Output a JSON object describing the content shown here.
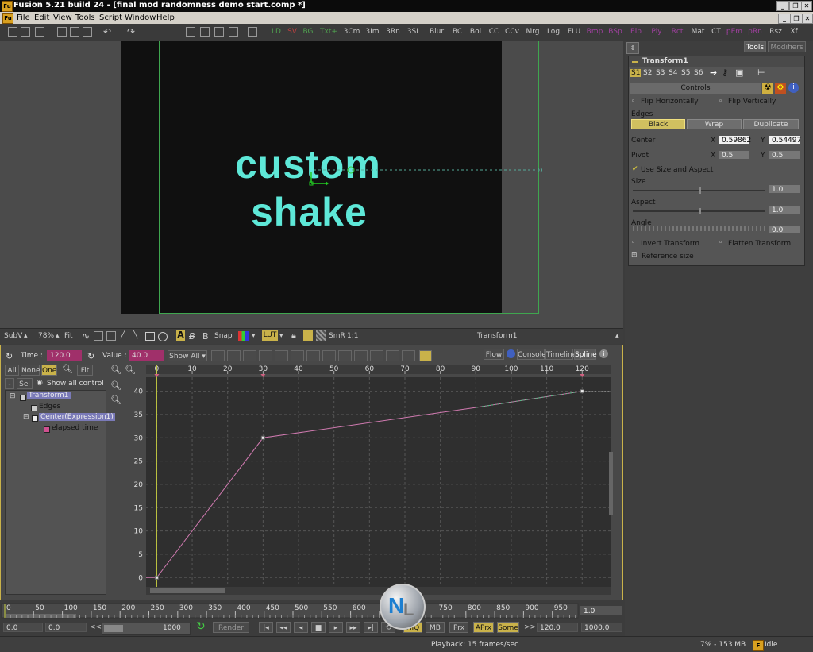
{
  "window": {
    "title": "Fusion 5.21 build 24 - [final mod randomness demo start.comp *]",
    "app_icon": "Fu"
  },
  "menu": [
    "File",
    "Edit",
    "View",
    "Tools",
    "Script",
    "Window",
    "Help"
  ],
  "toolbar": {
    "buttons": [
      "LD",
      "SV",
      "BG",
      "Txt+",
      "3Cm",
      "3Im",
      "3Rn",
      "3SL",
      "Blur",
      "BC",
      "Bol",
      "CC",
      "CCv",
      "Mrg",
      "Log",
      "FLU",
      "Bmp",
      "BSp",
      "Elp",
      "Ply",
      "Rct",
      "Mat",
      "CT",
      "pEm",
      "pRn",
      "Rsz",
      "Xf"
    ],
    "colors": {
      "LD": "#4fa04f",
      "SV": "#c04040",
      "BG": "#4fa04f",
      "Txt+": "#4fa04f",
      "pEm": "#a040a0",
      "pRn": "#a040a0",
      "Bmp": "#a040a0",
      "BSp": "#a040a0",
      "Elp": "#a040a0",
      "Ply": "#a040a0",
      "Rct": "#a040a0"
    }
  },
  "viewer": {
    "text_line1": "custom",
    "text_line2": "shake",
    "text_color": "#5ee8d8",
    "frame_color": "#3fa64f"
  },
  "viewer_bar": {
    "subview": "SubV",
    "zoom": "78%",
    "fit": "Fit",
    "letters": [
      "A",
      "B"
    ],
    "snap": "Snap",
    "lut": "LUT",
    "smr": "SmR",
    "ratio": "1:1",
    "tool_name": "Transform1"
  },
  "spline": {
    "time_label": "Time :",
    "time_value": "120.0",
    "value_label": "Value :",
    "value_value": "40.0",
    "show_all": "Show All",
    "filters": [
      "All",
      "None",
      "One"
    ],
    "fit": "Fit",
    "sel": "Sel",
    "show_all_control": "Show all control",
    "tabs": [
      "Flow",
      "Console",
      "Timeline",
      "Spline"
    ],
    "active_tab": "Spline",
    "tree": {
      "tool": "Transform1",
      "children": [
        "Edges",
        "Center(Expression1)"
      ],
      "grandchild": "elapsed time"
    }
  },
  "chart_data": {
    "type": "line",
    "x_ticks": [
      "0",
      "10",
      "20",
      "30",
      "40",
      "50",
      "60",
      "70",
      "80",
      "90",
      "100",
      "110",
      "120"
    ],
    "y_ticks": [
      "0",
      "5",
      "10",
      "15",
      "20",
      "25",
      "30",
      "35",
      "40"
    ],
    "xlim": [
      -3,
      128
    ],
    "ylim": [
      -2,
      43
    ],
    "series": [
      {
        "color": "#d07ab0",
        "x": [
          -10,
          0,
          30,
          90,
          120
        ],
        "y": [
          0,
          0,
          30,
          36.5,
          40
        ]
      }
    ],
    "keyframes": [
      {
        "x": 0,
        "y": 0
      },
      {
        "x": 30,
        "y": 30
      },
      {
        "x": 120,
        "y": 40
      }
    ],
    "current_time": 0
  },
  "time_ruler": {
    "ticks": [
      "0",
      "50",
      "100",
      "150",
      "200",
      "250",
      "300",
      "350",
      "400",
      "450",
      "500",
      "550",
      "600",
      "650",
      "700",
      "750",
      "800",
      "850",
      "900",
      "950"
    ],
    "current": "1.0"
  },
  "transport": {
    "start": "0.0",
    "render_start": "0.0",
    "render_end": "1000",
    "render_label": "Render",
    "toggles": [
      "HiQ",
      "MB",
      "Prx",
      "APrx",
      "Some"
    ],
    "end": "120.0",
    "global_end": "1000.0"
  },
  "status": {
    "playback": "Playback: 15 frames/sec",
    "memory": "7% - 153 MB",
    "state": "Idle"
  },
  "right_panel": {
    "tabs": [
      "Tools",
      "Modifiers"
    ],
    "tool_title": "Transform1",
    "subtabs": [
      "S1",
      "S2",
      "S3",
      "S4",
      "S5",
      "S6"
    ],
    "controls_label": "Controls",
    "flip_h": "Flip Horizontally",
    "flip_v": "Flip Vertically",
    "edges_label": "Edges",
    "edges_options": [
      "Black",
      "Wrap",
      "Duplicate"
    ],
    "edges_selected": "Black",
    "center_label": "Center",
    "center_x": "0.59862",
    "center_y": "0.54497",
    "pivot_label": "Pivot",
    "pivot_x": "0.5",
    "pivot_y": "0.5",
    "x_label": "X",
    "y_label": "Y",
    "use_size_aspect": "Use Size and Aspect",
    "size_label": "Size",
    "size_value": "1.0",
    "size_level": 0.5,
    "aspect_label": "Aspect",
    "aspect_value": "1.0",
    "aspect_level": 0.5,
    "angle_label": "Angle",
    "angle_value": "0.0",
    "invert": "Invert Transform",
    "flatten": "Flatten Transform",
    "reference_size": "Reference size"
  }
}
